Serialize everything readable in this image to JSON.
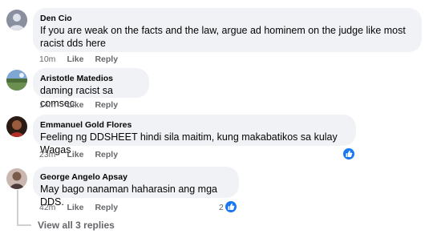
{
  "comments": [
    {
      "name": "Den Cio",
      "text": "If you are weak on the facts and the law, argue ad hominem on the judge like most racist dds here",
      "time": "10m",
      "like": "Like",
      "reply": "Reply",
      "avatar_icon": "default-profile-icon"
    },
    {
      "name": "Aristotle Matedios",
      "text": "daming racist sa comsec",
      "time": "14m",
      "like": "Like",
      "reply": "Reply",
      "avatar_icon": "landscape-photo-avatar"
    },
    {
      "name": "Emmanuel Gold Flores",
      "text": "Feeling ng DDSHEET hindi sila maitim, kung makabatikos sa kulay Wagas",
      "time": "23m",
      "like": "Like",
      "reply": "Reply",
      "reaction_icon": "thumbs-up-icon",
      "avatar_icon": "profile-photo-avatar"
    },
    {
      "name": "George Angelo Apsay",
      "text": "May bago nanaman haharasin ang mga DDS.",
      "time": "42m",
      "like": "Like",
      "reply": "Reply",
      "reaction_count": "2",
      "reaction_icon": "thumbs-up-icon",
      "avatar_icon": "profile-photo-avatar"
    }
  ],
  "view_replies": "View all 3 replies",
  "colors": {
    "bubble": "#f0f2f5",
    "meta_text": "#65676b",
    "like_blue": "#1877f2",
    "thread_line": "#ced0d4"
  }
}
